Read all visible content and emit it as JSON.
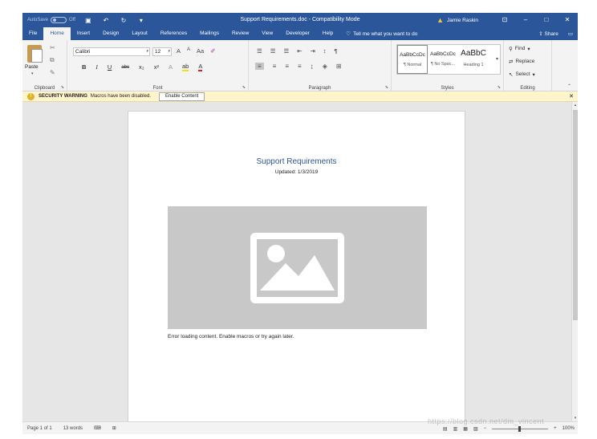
{
  "window": {
    "doc_title": "Support Requirements.doc - Compatibility Mode",
    "user_name": "Jamie Raskin",
    "autosave_label": "AutoSave",
    "autosave_state": "Off",
    "title_bar_color": "#2b579a"
  },
  "quick_access": {
    "save_icon": "save-icon",
    "undo_icon": "undo-icon",
    "redo_icon": "redo-icon",
    "customize_icon": "customize-qat-icon"
  },
  "ribbon_tabs": {
    "file": "File",
    "home": "Home",
    "insert": "Insert",
    "design": "Design",
    "layout": "Layout",
    "references": "References",
    "mailings": "Mailings",
    "review": "Review",
    "view": "View",
    "developer": "Developer",
    "help": "Help",
    "tell_me": "Tell me what you want to do",
    "share": "Share"
  },
  "ribbon": {
    "clipboard": {
      "label": "Clipboard",
      "paste": "Paste"
    },
    "font": {
      "label": "Font",
      "name": "Calibri",
      "size": "12",
      "bold": "B",
      "italic": "I",
      "underline": "U",
      "strike": "abc",
      "subscript": "x₂",
      "superscript": "x²",
      "grow": "A",
      "shrink": "A",
      "change_case": "Aa"
    },
    "paragraph": {
      "label": "Paragraph"
    },
    "styles": {
      "label": "Styles",
      "items": [
        {
          "sample": "AaBbCcDc",
          "name": "¶ Normal"
        },
        {
          "sample": "AaBbCcDc",
          "name": "¶ No Spac..."
        },
        {
          "sample": "AaBbC",
          "name": "Heading 1"
        }
      ]
    },
    "editing": {
      "label": "Editing",
      "find": "Find",
      "replace": "Replace",
      "select": "Select"
    }
  },
  "message_bar": {
    "title": "SECURITY WARNING",
    "text": "Macros have been disabled.",
    "button": "Enable Content",
    "background_color": "#fff4cc"
  },
  "document": {
    "heading": "Support Requirements",
    "updated": "Updated: 1/3/2019",
    "error_text": "Error loading content. Enable macros or try again later.",
    "heading_color": "#2f5496"
  },
  "status_bar": {
    "page": "Page 1 of 1",
    "words": "13 words",
    "zoom": "100%"
  },
  "watermark": "https://blog.csdn.net/dm_vincent"
}
